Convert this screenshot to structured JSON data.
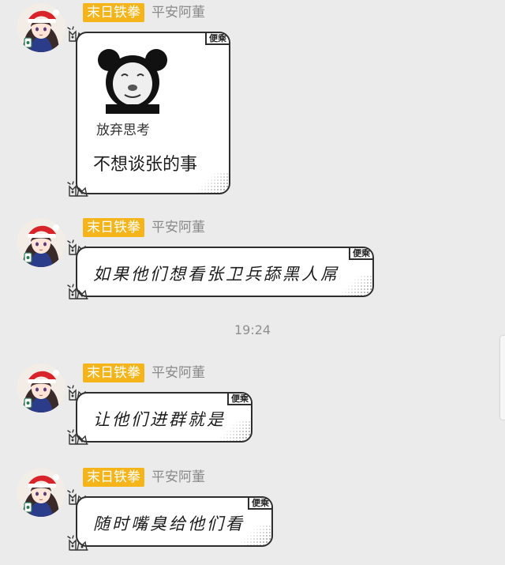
{
  "messages": [
    {
      "badge": "末日铁拳",
      "nick": "平安阿董",
      "tag": "便乘",
      "sticker_caption": "放弃思考",
      "text": "不想谈张的事"
    },
    {
      "badge": "末日铁拳",
      "nick": "平安阿董",
      "tag": "便乘",
      "text": "如果他们想看张卫兵舔黑人屌"
    },
    {
      "badge": "末日铁拳",
      "nick": "平安阿董",
      "tag": "便乘",
      "text": "让他们进群就是"
    },
    {
      "badge": "末日铁拳",
      "nick": "平安阿董",
      "tag": "便乘",
      "text": "随时嘴臭给他们看"
    }
  ],
  "timestamp": "19:24",
  "colors": {
    "badge": "#f4b41a",
    "background": "#ecebeb",
    "bubble_border": "#2e2e2e"
  },
  "icons": {
    "avatar": "anime-girl-santa-hat",
    "sticker": "panda-head-meme",
    "decoration": "cat-doodle-icon"
  }
}
